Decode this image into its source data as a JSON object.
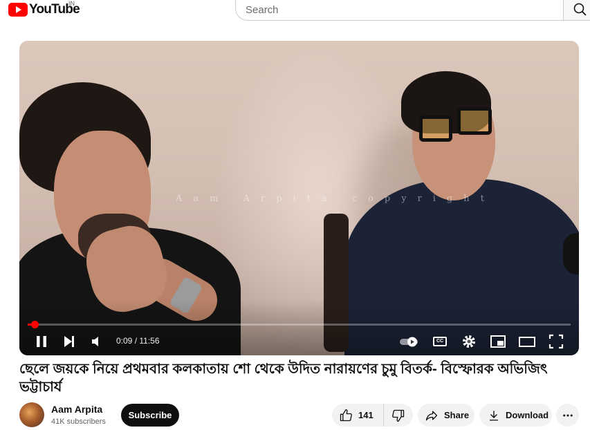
{
  "header": {
    "logo_text": "YouTube",
    "region": "IN",
    "search_placeholder": "Search"
  },
  "player": {
    "watermark": "Aam Arpita copyright",
    "time": "0:09 / 11:56",
    "progress": 0.013,
    "cc_label": "CC"
  },
  "video": {
    "title": "ছেলে জয়কে নিয়ে প্রথমবার কলকাতায় শো থেকে উদিত নারায়ণের চুমু বিতর্ক- বিস্ফোরক অভিজিৎ ভট্টাচার্য"
  },
  "channel": {
    "name": "Aam Arpita",
    "subscribers": "41K subscribers",
    "subscribe_label": "Subscribe"
  },
  "actions": {
    "likes": "141",
    "share_label": "Share",
    "download_label": "Download"
  },
  "colors": {
    "brand": "#ff0000",
    "progress": "#ff0000",
    "subscribe_bg": "#0f0f0f",
    "pill_bg": "#f2f2f2"
  }
}
